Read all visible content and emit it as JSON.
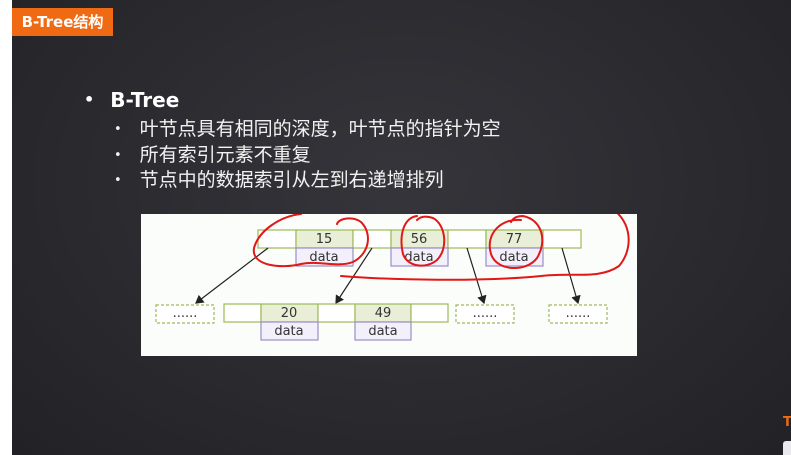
{
  "title_tab": "B-Tree结构",
  "bullets": {
    "main": "B-Tree",
    "items": [
      "叶节点具有相同的深度，叶节点的指针为空",
      "所有索引元素不重复",
      "节点中的数据索引从左到右递增排列"
    ]
  },
  "diagram": {
    "root_keys": [
      "15",
      "56",
      "77"
    ],
    "child_keys": [
      "20",
      "49"
    ],
    "data_label": "data",
    "ellipsis": "......"
  },
  "corner_logo": "T",
  "colors": {
    "tab": "#f06a14",
    "node_border": "#9dba57",
    "key_fill": "#e8efd6",
    "data_border": "#9a8fc4",
    "annotation": "#e01818"
  }
}
